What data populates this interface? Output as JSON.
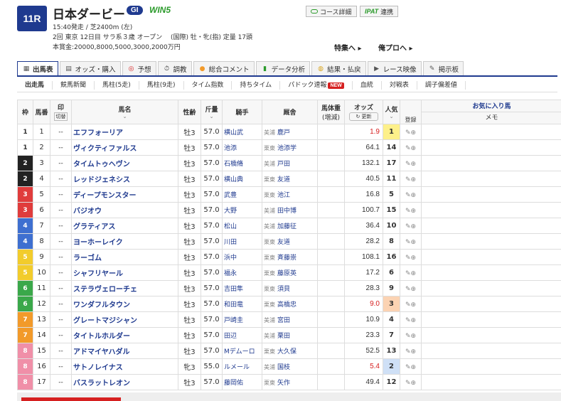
{
  "header": {
    "race_no": "11R",
    "race_name": "日本ダービー",
    "grade": "GI",
    "win5": "WIN5",
    "line1": "15:40発走 / 芝2400m (左)",
    "line2": "2回 東京 12日目 サラ系３歳 オープン　 (国際) 牡・牝(指) 定量 17頭",
    "line3": "本賞金:20000,8000,5000,3000,2000万円",
    "course_btn": "コース詳細",
    "ipat_logo": "IPAT",
    "ipat_btn": "連携",
    "feature_link": "特集へ ▸",
    "pro_link": "俺プロへ ▸"
  },
  "tabs": [
    {
      "label": "出馬表",
      "icon": "table-icon",
      "active": true
    },
    {
      "label": "オッズ・購入",
      "icon": "odds-icon"
    },
    {
      "label": "予想",
      "icon": "target-icon"
    },
    {
      "label": "調教",
      "icon": "stopwatch-icon"
    },
    {
      "label": "総合コメント",
      "icon": "comment-icon"
    },
    {
      "label": "データ分析",
      "icon": "bar-chart-icon"
    },
    {
      "label": "結果・払戻",
      "icon": "coins-icon"
    },
    {
      "label": "レース映像",
      "icon": "video-icon"
    },
    {
      "label": "掲示板",
      "icon": "board-icon"
    }
  ],
  "subtabs": [
    {
      "label": "出走馬",
      "active": true
    },
    {
      "label": "競馬新聞"
    },
    {
      "label": "馬柱(5走)"
    },
    {
      "label": "馬柱(9走)"
    },
    {
      "label": "タイム指数"
    },
    {
      "label": "持ちタイム"
    },
    {
      "label": "パドック速報",
      "badge": "NEW"
    },
    {
      "label": "血統"
    },
    {
      "label": "対戦表"
    },
    {
      "label": "調子偏差値"
    }
  ],
  "columns": {
    "waku": "枠",
    "umaban": "馬番",
    "mark": "印",
    "mark_sub": "切替",
    "horse": "馬名",
    "sex_age": "性齢",
    "weight": "斤量",
    "jockey": "騎手",
    "trainer": "厩舎",
    "body_weight": "馬体重",
    "body_weight_sub": "(増減)",
    "odds": "オッズ",
    "odds_update": "更新",
    "popularity": "人気",
    "register": "登録",
    "favorite": "お気に入り馬",
    "memo": "メモ"
  },
  "waku_colors": {
    "1": [
      "#ffffff",
      "#333333"
    ],
    "2": [
      "#222222",
      "#ffffff"
    ],
    "3": [
      "#e03c3c",
      "#ffffff"
    ],
    "4": [
      "#3e6fd0",
      "#ffffff"
    ],
    "5": [
      "#f2cc2c",
      "#ffffff"
    ],
    "6": [
      "#3aa84a",
      "#ffffff"
    ],
    "7": [
      "#f29a2a",
      "#ffffff"
    ],
    "8": [
      "#f08fa8",
      "#ffffff"
    ]
  },
  "horses": [
    {
      "waku": "1",
      "num": "1",
      "mark": "--",
      "name": "エフフォーリア",
      "sex_age": "牡3",
      "weight": "57.0",
      "jockey": "横山武",
      "region": "美浦",
      "trainer": "鹿戸",
      "odds": "1.9",
      "hot": true,
      "pop": "1",
      "pop_bg": "#fdf08a"
    },
    {
      "waku": "1",
      "num": "2",
      "mark": "--",
      "name": "ヴィクティファルス",
      "sex_age": "牡3",
      "weight": "57.0",
      "jockey": "池添",
      "region": "栗東",
      "trainer": "池添学",
      "odds": "64.1",
      "pop": "14"
    },
    {
      "waku": "2",
      "num": "3",
      "mark": "--",
      "name": "タイムトゥヘヴン",
      "sex_age": "牡3",
      "weight": "57.0",
      "jockey": "石橋脩",
      "region": "美浦",
      "trainer": "戸田",
      "odds": "132.1",
      "pop": "17"
    },
    {
      "waku": "2",
      "num": "4",
      "mark": "--",
      "name": "レッドジェネシス",
      "sex_age": "牡3",
      "weight": "57.0",
      "jockey": "横山典",
      "region": "栗東",
      "trainer": "友道",
      "odds": "40.5",
      "pop": "11"
    },
    {
      "waku": "3",
      "num": "5",
      "mark": "--",
      "name": "ディープモンスター",
      "sex_age": "牡3",
      "weight": "57.0",
      "jockey": "武豊",
      "region": "栗東",
      "trainer": "池江",
      "odds": "16.8",
      "pop": "5"
    },
    {
      "waku": "3",
      "num": "6",
      "mark": "--",
      "name": "バジオウ",
      "sex_age": "牡3",
      "weight": "57.0",
      "jockey": "大野",
      "region": "美浦",
      "trainer": "田中博",
      "odds": "100.7",
      "pop": "15"
    },
    {
      "waku": "4",
      "num": "7",
      "mark": "--",
      "name": "グラティアス",
      "sex_age": "牡3",
      "weight": "57.0",
      "jockey": "松山",
      "region": "美浦",
      "trainer": "加藤征",
      "odds": "36.4",
      "pop": "10"
    },
    {
      "waku": "4",
      "num": "8",
      "mark": "--",
      "name": "ヨーホーレイク",
      "sex_age": "牡3",
      "weight": "57.0",
      "jockey": "川田",
      "region": "栗東",
      "trainer": "友道",
      "odds": "28.2",
      "pop": "8"
    },
    {
      "waku": "5",
      "num": "9",
      "mark": "--",
      "name": "ラーゴム",
      "sex_age": "牡3",
      "weight": "57.0",
      "jockey": "浜中",
      "region": "栗東",
      "trainer": "斉藤崇",
      "odds": "108.1",
      "pop": "16"
    },
    {
      "waku": "5",
      "num": "10",
      "mark": "--",
      "name": "シャフリヤール",
      "sex_age": "牡3",
      "weight": "57.0",
      "jockey": "福永",
      "region": "栗東",
      "trainer": "藤原英",
      "odds": "17.2",
      "pop": "6"
    },
    {
      "waku": "6",
      "num": "11",
      "mark": "--",
      "name": "ステラヴェローチェ",
      "sex_age": "牡3",
      "weight": "57.0",
      "jockey": "吉田隼",
      "region": "栗東",
      "trainer": "須貝",
      "odds": "28.3",
      "pop": "9"
    },
    {
      "waku": "6",
      "num": "12",
      "mark": "--",
      "name": "ワンダフルタウン",
      "sex_age": "牡3",
      "weight": "57.0",
      "jockey": "和田竜",
      "region": "栗東",
      "trainer": "高橋忠",
      "odds": "9.0",
      "hot": true,
      "pop": "3",
      "pop_bg": "#fbd3b3"
    },
    {
      "waku": "7",
      "num": "13",
      "mark": "--",
      "name": "グレートマジシャン",
      "sex_age": "牡3",
      "weight": "57.0",
      "jockey": "戸崎圭",
      "region": "美浦",
      "trainer": "宮田",
      "odds": "10.9",
      "pop": "4"
    },
    {
      "waku": "7",
      "num": "14",
      "mark": "--",
      "name": "タイトルホルダー",
      "sex_age": "牡3",
      "weight": "57.0",
      "jockey": "田辺",
      "region": "美浦",
      "trainer": "栗田",
      "odds": "23.3",
      "pop": "7"
    },
    {
      "waku": "8",
      "num": "15",
      "mark": "--",
      "name": "アドマイヤハダル",
      "sex_age": "牡3",
      "weight": "57.0",
      "jockey": "Mデムーロ",
      "region": "栗東",
      "trainer": "大久保",
      "odds": "52.5",
      "pop": "13"
    },
    {
      "waku": "8",
      "num": "16",
      "mark": "--",
      "name": "サトノレイナス",
      "sex_age": "牝3",
      "weight": "55.0",
      "jockey": "ルメール",
      "region": "美浦",
      "trainer": "国枝",
      "odds": "5.4",
      "hot": true,
      "pop": "2",
      "pop_bg": "#cfe0f6"
    },
    {
      "waku": "8",
      "num": "17",
      "mark": "--",
      "name": "バスラットレオン",
      "sex_age": "牡3",
      "weight": "57.0",
      "jockey": "藤岡佑",
      "region": "栗東",
      "trainer": "矢作",
      "odds": "49.4",
      "pop": "12"
    }
  ]
}
